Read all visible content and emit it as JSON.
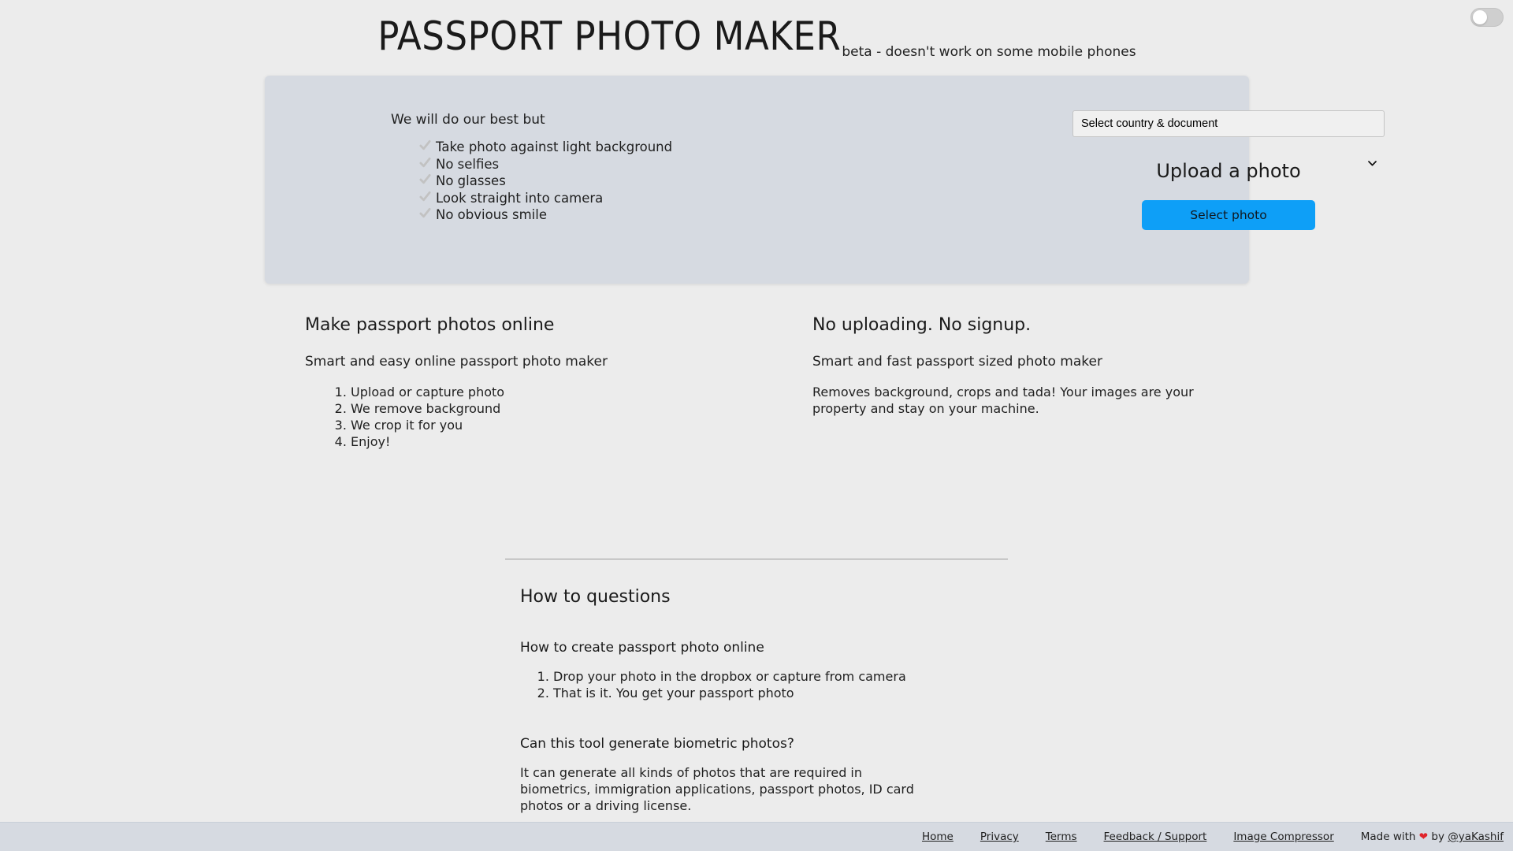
{
  "theme_toggle": {
    "name": "dark-mode-toggle",
    "state": "off"
  },
  "header": {
    "title": "PASSPORT PHOTO MAKER",
    "tagline": "beta - doesn't work on some mobile phones"
  },
  "hero": {
    "intro": "We will do our best but",
    "check_icon": "check-mark-icon",
    "tips": [
      "Take photo against light background",
      "No selfies",
      "No glasses",
      "Look straight into camera",
      "No obvious smile"
    ],
    "country_select": {
      "selected": "Select country & document",
      "options": [
        "Select country & document"
      ],
      "chevron_icon": "chevron-down-icon"
    },
    "upload_title": "Upload a photo",
    "select_photo_label": "Select photo",
    "accent_color": "#0e9ff7",
    "card_color": "#d6dae1"
  },
  "features": {
    "left": {
      "heading": "Make passport photos online",
      "sub": "Smart and easy online passport photo maker",
      "steps": [
        "Upload or capture photo",
        "We remove background",
        "We crop it for you",
        "Enjoy!"
      ]
    },
    "right": {
      "heading": "No uploading. No signup.",
      "sub": "Smart and fast passport sized photo maker",
      "body": "Removes background, crops and tada! Your images are your property and stay on your machine."
    }
  },
  "faq": {
    "title": "How to questions",
    "q1": "How to create passport photo online",
    "q1_steps": [
      "Drop your photo in the dropbox or capture from camera",
      "That is it. You get your passport photo"
    ],
    "q2": "Can this tool generate biometric photos?",
    "q2_answer": "It can generate all kinds of photos that are required in biometrics, immigration applications, passport photos, ID card photos or a driving license."
  },
  "footer": {
    "links": [
      "Home",
      "Privacy",
      "Terms",
      "Feedback / Support",
      "Image Compressor"
    ],
    "credit_prefix": "Made with",
    "heart_icon": "heart-icon",
    "credit_by": "by",
    "author": "@yaKashif"
  }
}
